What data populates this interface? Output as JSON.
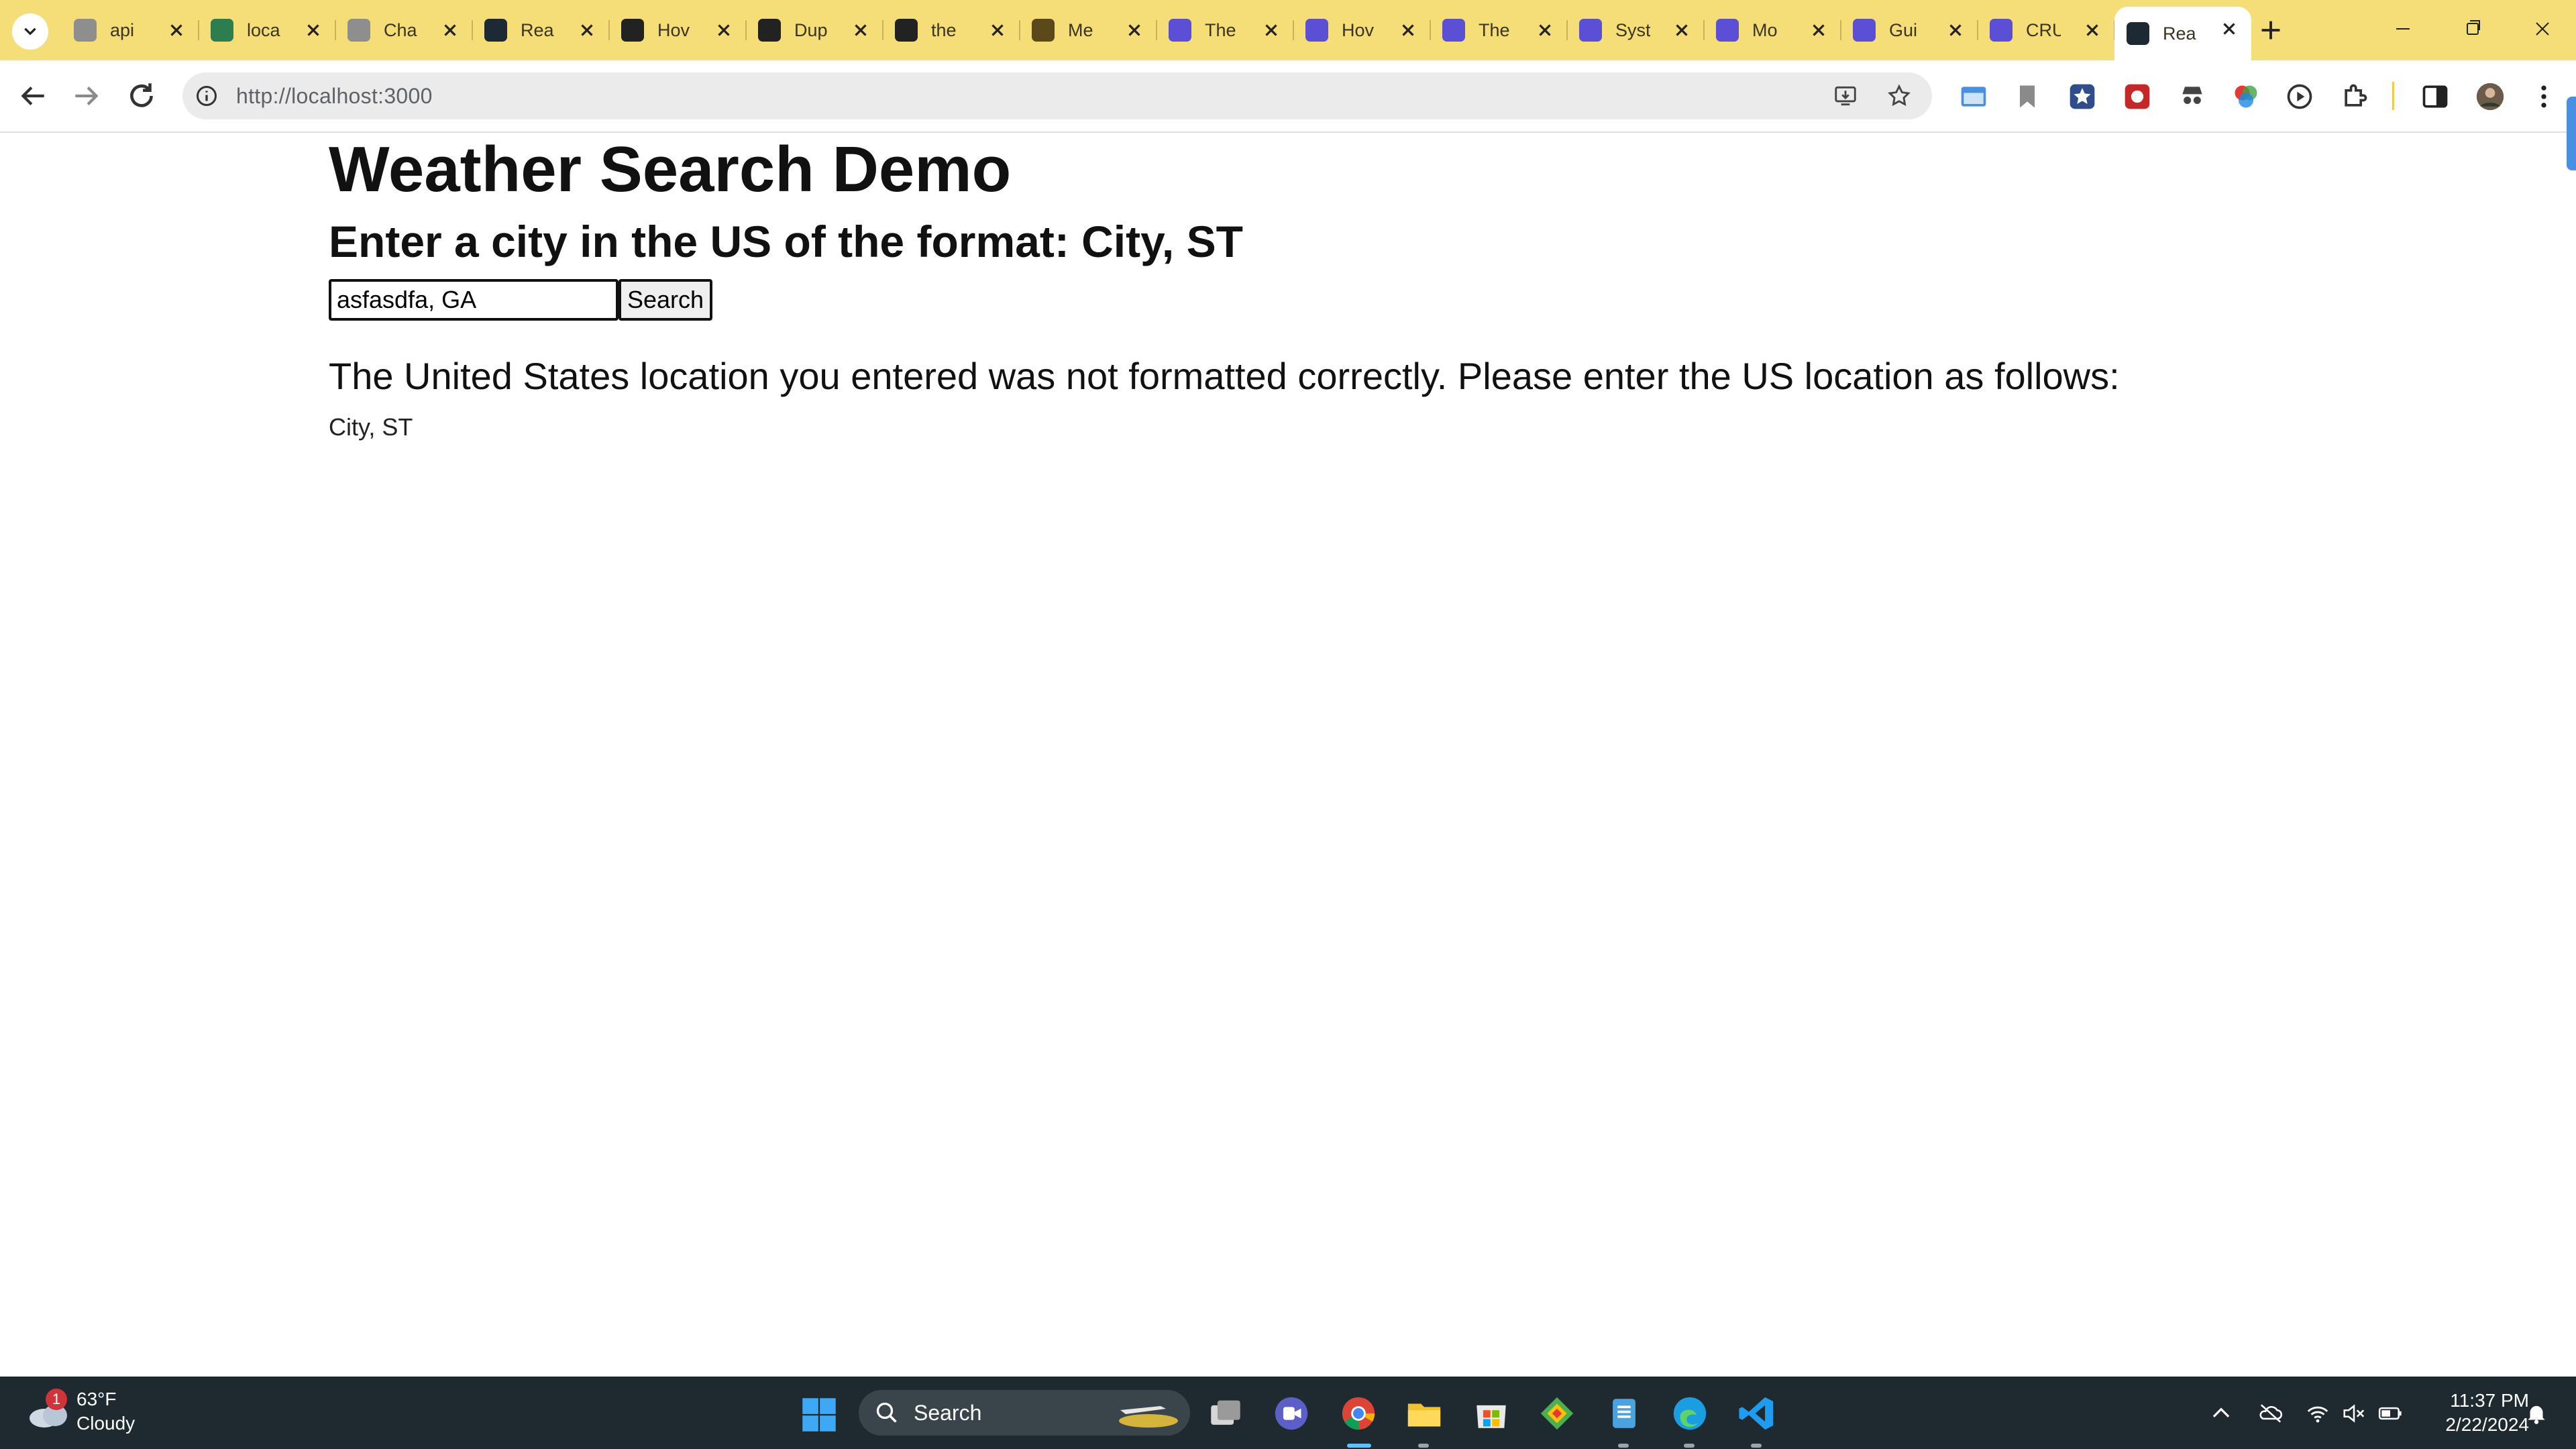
{
  "tabs": [
    {
      "title": "api",
      "favicon": "openai-icon",
      "color": "#8e8e8e"
    },
    {
      "title": "loca",
      "favicon": "chart-app-icon",
      "color": "#2e7d4f"
    },
    {
      "title": "Cha",
      "favicon": "chatgpt-icon",
      "color": "#8e8e8e"
    },
    {
      "title": "Rea",
      "favicon": "react-icon",
      "color": "#1e2a33"
    },
    {
      "title": "Hov",
      "favicon": "openai-icon",
      "color": "#222222"
    },
    {
      "title": "Dup",
      "favicon": "github-icon",
      "color": "#222222"
    },
    {
      "title": "the",
      "favicon": "github-icon",
      "color": "#222222"
    },
    {
      "title": "Me",
      "favicon": "house-icon",
      "color": "#5a4a1a"
    },
    {
      "title": "The",
      "favicon": "terminal-icon",
      "color": "#5b4fd6"
    },
    {
      "title": "Hov",
      "favicon": "terminal-icon",
      "color": "#5b4fd6"
    },
    {
      "title": "The",
      "favicon": "terminal-icon",
      "color": "#5b4fd6"
    },
    {
      "title": "Syst",
      "favicon": "terminal-icon",
      "color": "#5b4fd6"
    },
    {
      "title": "Mo",
      "favicon": "terminal-icon",
      "color": "#5b4fd6"
    },
    {
      "title": "Gui",
      "favicon": "terminal-icon",
      "color": "#5b4fd6"
    },
    {
      "title": "CRU",
      "favicon": "terminal-icon",
      "color": "#5b4fd6"
    },
    {
      "title": "Rea",
      "favicon": "react-icon",
      "color": "#1e2a33",
      "active": true
    }
  ],
  "browser": {
    "url": "http://localhost:3000",
    "accent": "#f5dd78"
  },
  "page": {
    "title": "Weather Search Demo",
    "instruction": "Enter a city in the US of the format: City, ST",
    "search_value": "asfasdfa, GA",
    "search_button": "Search",
    "error_message": "The United States location you entered was not formatted correctly. Please enter the US location as follows:",
    "format_hint": "City, ST"
  },
  "taskbar": {
    "weather_temp": "63°F",
    "weather_condition": "Cloudy",
    "weather_badge": "1",
    "search_label": "Search",
    "time": "11:37 PM",
    "date": "2/22/2024"
  }
}
